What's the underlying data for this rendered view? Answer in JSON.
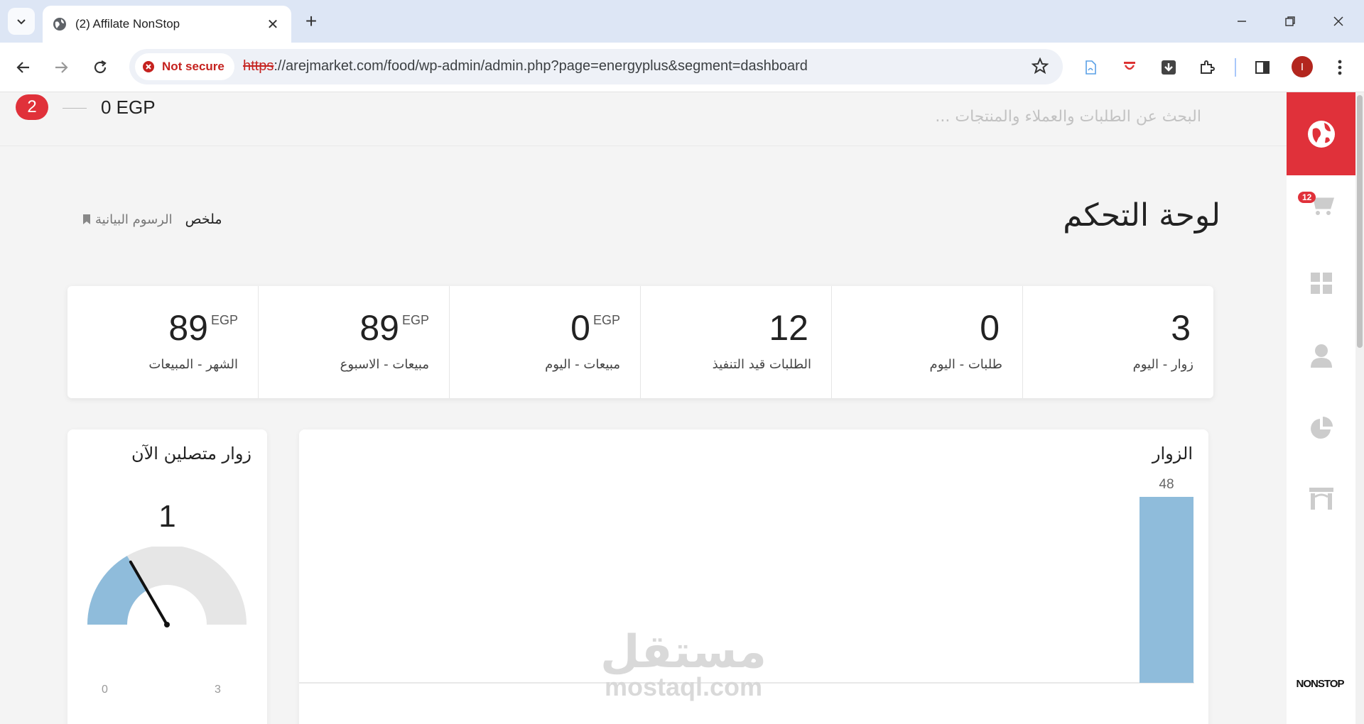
{
  "browser": {
    "tab_title": "(2) Affilate NonStop",
    "secure_label": "Not secure",
    "url_scheme": "https",
    "url_rest": "://arejmarket.com/food/wp-admin/admin.php?page=energyplus&segment=dashboard",
    "profile_initial": "I"
  },
  "topbar": {
    "notification_count": "2",
    "balance": "0 EGP",
    "search_placeholder": "البحث عن الطلبات والعملاء والمنتجات ..."
  },
  "sidebar": {
    "cart_count": "12",
    "logo_text": "NONSTOP",
    "icons": [
      "globe-icon",
      "cart-icon",
      "grid-icon",
      "user-icon",
      "pie-chart-icon",
      "store-icon"
    ]
  },
  "dashboard": {
    "title": "لوحة التحكم",
    "tab_summary": "ملخص",
    "tab_charts": "الرسوم البيانية"
  },
  "stats": [
    {
      "value": "3",
      "currency": "",
      "label": "زوار - اليوم"
    },
    {
      "value": "0",
      "currency": "",
      "label": "طلبات - اليوم"
    },
    {
      "value": "12",
      "currency": "",
      "label": "الطلبات قيد التنفيذ"
    },
    {
      "value": "0",
      "currency": "EGP",
      "label": "مبيعات - اليوم"
    },
    {
      "value": "89",
      "currency": "EGP",
      "label": "مبيعات - الاسبوع"
    },
    {
      "value": "89",
      "currency": "EGP",
      "label": "الشهر - المبيعات"
    }
  ],
  "online": {
    "title": "زوار متصلين الآن",
    "count": "1",
    "min": "0",
    "max": "3",
    "value_fraction": 0.333
  },
  "visitors_chart": {
    "title": "الزوار"
  },
  "chart_data": {
    "type": "bar",
    "categories": [
      ""
    ],
    "values": [
      48
    ],
    "title": "الزوار",
    "xlabel": "",
    "ylabel": "",
    "color": "#8fbcdb"
  },
  "watermark": {
    "arabic": "مستقل",
    "latin": "mostaql.com"
  },
  "colors": {
    "accent": "#e0313a",
    "bar": "#8fbcdb"
  }
}
